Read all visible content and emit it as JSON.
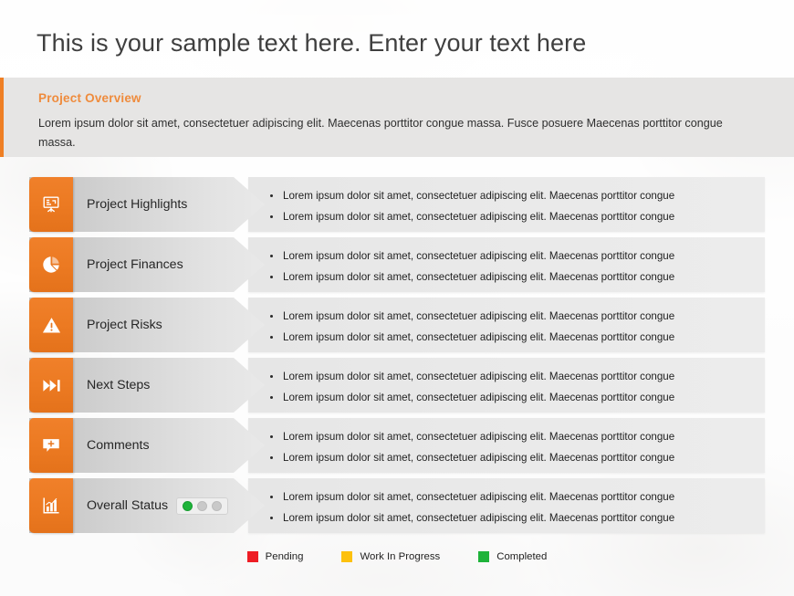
{
  "slide": {
    "title": "This is your sample text here. Enter your text here"
  },
  "overview": {
    "heading": "Project Overview",
    "body": "Lorem ipsum dolor sit amet, consectetuer adipiscing elit. Maecenas porttitor congue massa. Fusce posuere Maecenas porttitor congue massa."
  },
  "accent_color": "#ef7f24",
  "bullet_text": "Lorem ipsum dolor sit amet, consectetuer adipiscing elit. Maecenas porttitor congue",
  "rows": [
    {
      "label": "Project Highlights",
      "icon": "presentation-board-icon",
      "bullets": [
        "Lorem ipsum dolor sit amet, consectetuer adipiscing elit. Maecenas porttitor congue",
        "Lorem ipsum dolor sit amet, consectetuer adipiscing elit. Maecenas porttitor congue"
      ]
    },
    {
      "label": "Project Finances",
      "icon": "pie-chart-icon",
      "bullets": [
        "Lorem ipsum dolor sit amet, consectetuer adipiscing elit. Maecenas porttitor congue",
        "Lorem ipsum dolor sit amet, consectetuer adipiscing elit. Maecenas porttitor congue"
      ]
    },
    {
      "label": "Project Risks",
      "icon": "warning-triangle-icon",
      "bullets": [
        "Lorem ipsum dolor sit amet, consectetuer adipiscing elit. Maecenas porttitor congue",
        "Lorem ipsum dolor sit amet, consectetuer adipiscing elit. Maecenas porttitor congue"
      ]
    },
    {
      "label": "Next Steps",
      "icon": "skip-forward-icon",
      "bullets": [
        "Lorem ipsum dolor sit amet, consectetuer adipiscing elit. Maecenas porttitor congue",
        "Lorem ipsum dolor sit amet, consectetuer adipiscing elit. Maecenas porttitor congue"
      ]
    },
    {
      "label": "Comments",
      "icon": "comment-add-icon",
      "bullets": [
        "Lorem ipsum dolor sit amet, consectetuer adipiscing elit. Maecenas porttitor congue",
        "Lorem ipsum dolor sit amet, consectetuer adipiscing elit. Maecenas porttitor congue"
      ]
    },
    {
      "label": "Overall Status",
      "icon": "bar-chart-icon",
      "status": {
        "active": "Completed",
        "active_index": 0,
        "dots": 3
      },
      "bullets": [
        "Lorem ipsum dolor sit amet, consectetuer adipiscing elit. Maecenas porttitor congue",
        "Lorem ipsum dolor sit amet, consectetuer adipiscing elit. Maecenas porttitor congue"
      ]
    }
  ],
  "legend": [
    {
      "label": "Pending",
      "color": "#ee1d25"
    },
    {
      "label": "Work In Progress",
      "color": "#fdc10d"
    },
    {
      "label": "Completed",
      "color": "#1eb33a"
    }
  ]
}
